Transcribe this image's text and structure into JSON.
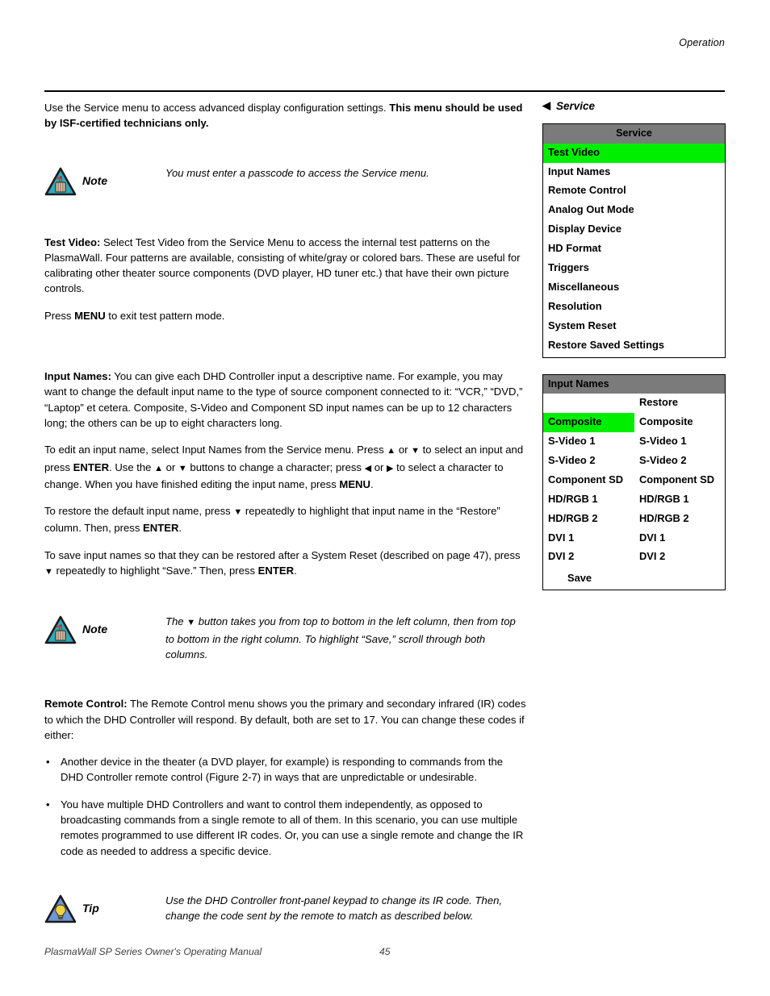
{
  "header": {
    "running_head": "Operation"
  },
  "left_column": {
    "intro": {
      "text_normal": "Use the Service menu to access advanced display configuration settings. ",
      "text_bold": "This menu should be used by ISF-certified technicians only."
    },
    "note_1": {
      "label": "Note",
      "icon": "note-triangle-hand-icon",
      "body": "You must enter a passcode to access the Service menu."
    },
    "test_video": {
      "heading": "Test Video:",
      "body": " Select Test Video from the Service Menu to access the internal test patterns on the PlasmaWall. Four patterns are available, consisting of white/gray or colored bars. These are useful for calibrating other theater source components (DVD player, HD tuner etc.) that have their own picture controls.",
      "press_menu_pre": "Press ",
      "press_menu_bold": "MENU",
      "press_menu_post": " to exit test pattern mode."
    },
    "input_names": {
      "heading": "Input Names:",
      "para1": " You can give each DHD Controller input a descriptive name. For example, you may want to change the default input name to the type of source component connected to it: “VCR,” “DVD,” “Laptop” et cetera. Composite, S-Video and Component SD input names can be up to 12 characters long; the others can be up to eight characters long.",
      "para2_a": "To edit an input name, select Input Names from the Service menu. Press ",
      "para2_up1": "▲",
      "para2_b": " or ",
      "para2_dn1": "▼",
      "para2_c": " to select an input and press ",
      "para2_enter": "ENTER",
      "para2_d": ". Use the ",
      "para2_up2": "▲",
      "para2_e": " or ",
      "para2_dn2": "▼",
      "para2_f": " buttons to change a character; press ",
      "para2_left": "◀",
      "para2_g": " or ",
      "para2_right": "▶",
      "para2_h": " to select a character to change. When you have finished editing the input name, press ",
      "para2_menu": "MENU",
      "para2_i": ".",
      "para3_a": "To restore the default input name, press ",
      "para3_dn": "▼",
      "para3_b": " repeatedly to highlight that input name in the “Restore” column. Then, press ",
      "para3_enter": "ENTER",
      "para3_c": ".",
      "para4_a": "To save input names so that they can be restored after a System Reset (described on page 47), press ",
      "para4_dn": "▼",
      "para4_b": " repeatedly to highlight “Save.” Then, press ",
      "para4_enter": "ENTER",
      "para4_c": "."
    },
    "note_2": {
      "label": "Note",
      "icon": "note-triangle-hand-icon",
      "body_a": "The ",
      "body_arrow": "▼",
      "body_b": " button takes you from top to bottom in the left column, then from top to bottom in the right column. To highlight “Save,” scroll through both columns."
    },
    "remote_control": {
      "heading": "Remote Control:",
      "body": " The Remote Control menu shows you the primary and secondary infrared (IR) codes to which the DHD Controller will respond. By default, both are set to 17. You can change these codes if either:",
      "bullets": [
        "Another device in the theater (a DVD player, for example) is responding to commands from the DHD Controller remote control (Figure 2-7) in ways that are unpredictable or undesirable.",
        "You have multiple DHD Controllers and want to control them independently, as opposed to broadcasting commands from a single remote to all of them. In this scenario, you can use multiple remotes programmed to use different IR codes. Or, you can use a single remote and change the IR code as needed to address a specific device."
      ],
      "bullet_glyph": "•"
    },
    "tip": {
      "label": "Tip",
      "icon": "tip-triangle-lightbulb-icon",
      "body": "Use the DHD Controller front-panel keypad to change its IR code. Then, change the code sent by the remote to match as described below."
    }
  },
  "right_column": {
    "osd_title": {
      "back_arrow": "◀",
      "label": "Service"
    },
    "service_menu": {
      "header": "Service",
      "selected_index": 0,
      "items": [
        "Test Video",
        "Input Names",
        "Remote Control",
        "Analog Out Mode",
        "Display Device",
        "HD Format",
        "Triggers",
        "Miscellaneous",
        "Resolution",
        "System Reset",
        "Restore Saved Settings"
      ]
    },
    "input_names_menu": {
      "header": "Input Names",
      "restore_label": "Restore",
      "selected_row": 0,
      "rows": [
        {
          "name": "Composite",
          "restore": "Composite"
        },
        {
          "name": "S-Video 1",
          "restore": "S-Video 1"
        },
        {
          "name": "S-Video 2",
          "restore": "S-Video 2"
        },
        {
          "name": "Component SD",
          "restore": "Component SD"
        },
        {
          "name": "HD/RGB 1",
          "restore": "HD/RGB 1"
        },
        {
          "name": "HD/RGB 2",
          "restore": "HD/RGB 2"
        },
        {
          "name": "DVI 1",
          "restore": "DVI 1"
        },
        {
          "name": "DVI 2",
          "restore": "DVI 2"
        }
      ],
      "save_label": "Save"
    }
  },
  "footer": {
    "manual_name": "PlasmaWall SP Series Owner's Operating Manual",
    "page_number": "45"
  },
  "colors": {
    "osd_header_gray": "#7b7b7b",
    "osd_highlight_green": "#00ee00",
    "note_icon_fill": "#2fa8bd",
    "tip_icon_fill": "#6f96d6",
    "tip_bulb_yellow": "#f4d33c",
    "text_black": "#000000"
  }
}
